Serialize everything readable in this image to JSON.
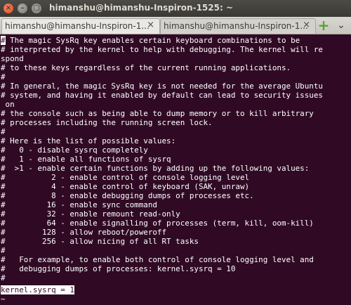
{
  "window": {
    "title": "himanshu@himanshu-Inspiron-1525: ~",
    "close_glyph": "×",
    "minimize_glyph": "–",
    "maximize_glyph": "▢"
  },
  "tabs": [
    {
      "label": "himanshu@himanshu-Inspiron-1...",
      "close": "×"
    },
    {
      "label": "himanshu@himanshu-Inspiron-1...",
      "close": "×"
    }
  ],
  "new_tab_glyph": "+",
  "tab_menu_glyph": "⌄",
  "colors": {
    "terminal_bg": "#300a24",
    "terminal_fg": "#ffffff",
    "new_tab_icon": "#56a233"
  },
  "cursor_char": "#",
  "lines": [
    "# The magic SysRq key enables certain keyboard combinations to be",
    "# interpreted by the kernel to help with debugging. The kernel will re",
    "spond",
    "# to these keys regardless of the current running applications.",
    "#",
    "# In general, the magic SysRq key is not needed for the average Ubuntu",
    "# system, and having it enabled by default can lead to security issues",
    " on",
    "# the console such as being able to dump memory or to kill arbitrary",
    "# processes including the running screen lock.",
    "#",
    "# Here is the list of possible values:",
    "#   0 - disable sysrq completely",
    "#   1 - enable all functions of sysrq",
    "#  >1 - enable certain functions by adding up the following values:",
    "#          2 - enable control of console logging level",
    "#          4 - enable control of keyboard (SAK, unraw)",
    "#          8 - enable debugging dumps of processes etc.",
    "#         16 - enable sync command",
    "#         32 - enable remount read-only",
    "#         64 - enable signalling of processes (term, kill, oom-kill)",
    "#        128 - allow reboot/poweroff",
    "#        256 - allow nicing of all RT tasks",
    "#",
    "#   For example, to enable both control of console logging level and",
    "#   debugging dumps of processes: kernel.sysrq = 10",
    "#",
    "kernel.sysrq = 1",
    "~"
  ]
}
